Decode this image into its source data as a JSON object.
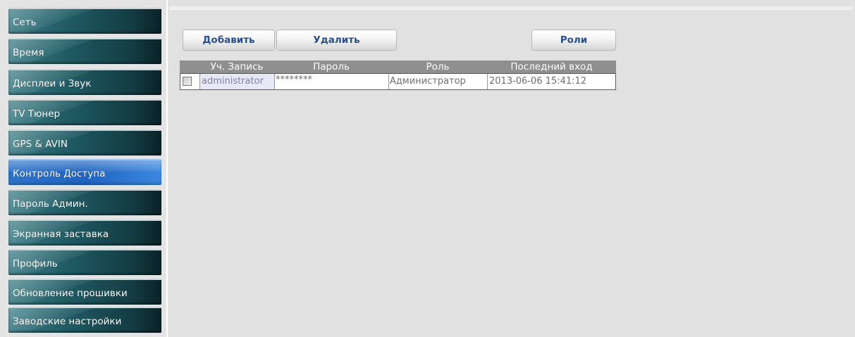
{
  "sidebar": {
    "items": [
      {
        "label": "Сеть",
        "active": false
      },
      {
        "label": "Время",
        "active": false
      },
      {
        "label": "Дисплеи и Звук",
        "active": false
      },
      {
        "label": "TV Тюнер",
        "active": false
      },
      {
        "label": "GPS & AVIN",
        "active": false
      },
      {
        "label": "Контроль Доступа",
        "active": true
      },
      {
        "label": "Пароль Админ.",
        "active": false
      },
      {
        "label": "Экранная заставка",
        "active": false
      },
      {
        "label": "Профиль",
        "active": false
      },
      {
        "label": "Обновление прошивки",
        "active": false
      },
      {
        "label": "Заводские настройки",
        "active": false
      }
    ]
  },
  "toolbar": {
    "add_label": "Добавить",
    "delete_label": "Удалить",
    "roles_label": "Роли"
  },
  "table": {
    "columns": [
      "Уч. Запись",
      "Пароль",
      "Роль",
      "Последний вход"
    ],
    "rows": [
      {
        "checked": false,
        "account": "administrator",
        "password": "********",
        "role": "Администратор",
        "last_login": "2013-06-06 15:41:12"
      }
    ]
  },
  "colors": {
    "sidebar_item": "#1f5a63",
    "sidebar_active": "#1e63c0",
    "button_text": "#2a4f8a",
    "table_header": "#8f8f8f",
    "panel_bg": "#e1e1e1"
  }
}
